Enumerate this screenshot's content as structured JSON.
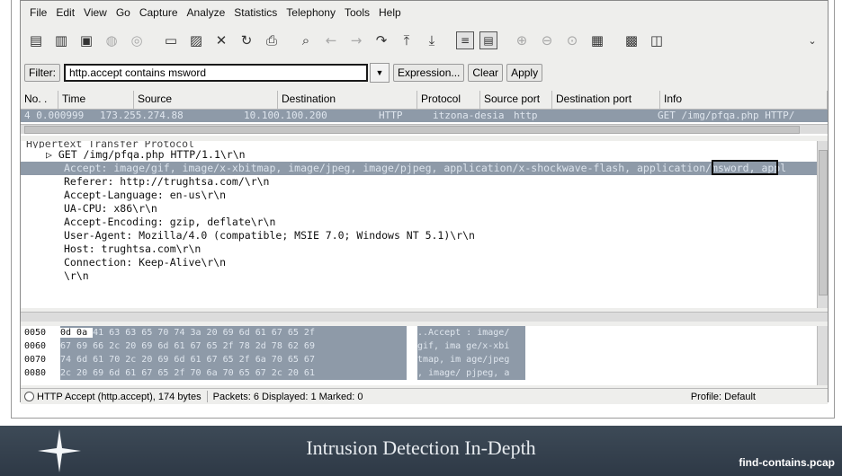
{
  "menu": [
    "File",
    "Edit",
    "View",
    "Go",
    "Capture",
    "Analyze",
    "Statistics",
    "Telephony",
    "Tools",
    "Help"
  ],
  "filter": {
    "label": "Filter:",
    "value": "http.accept contains msword",
    "expression_btn": "Expression...",
    "clear_btn": "Clear",
    "apply_btn": "Apply"
  },
  "packet_list": {
    "columns": [
      "No. .",
      "Time",
      "Source",
      "Destination",
      "Protocol",
      "Source port",
      "Destination port",
      "Info"
    ],
    "row": [
      "4 0.000999",
      "173.255.274.88",
      "10.100.100.200",
      "HTTP",
      "itzona-desia",
      "http",
      "",
      "GET /img/pfqa.php HTTP/"
    ]
  },
  "details": {
    "top": "Hypertext Transfer Protocol",
    "request_line": "GET /img/pfqa.php HTTP/1.1\\r\\n",
    "accept": "Accept: image/gif, image/x-xbitmap, image/jpeg, image/pjpeg, application/x-shockwave-flash, application/msword, appl",
    "headers": [
      "Referer: http://trughtsa.com/\\r\\n",
      "Accept-Language: en-us\\r\\n",
      "UA-CPU: x86\\r\\n",
      "Accept-Encoding: gzip, deflate\\r\\n",
      "User-Agent: Mozilla/4.0 (compatible; MSIE 7.0; Windows NT 5.1)\\r\\n",
      "Host: trughtsa.com\\r\\n",
      "Connection: Keep-Alive\\r\\n",
      "\\r\\n"
    ]
  },
  "bytes": [
    {
      "offset": "0050",
      "hex_pre": "0d 0a ",
      "hex": "41 63 63 65 70 74  3a 20 69 6d 61 67 65 2f",
      "ascii": "..Accept : image/"
    },
    {
      "offset": "0060",
      "hex_pre": "",
      "hex": "67 69 66 2c 20 69 6d 61  67 65 2f 78 2d 78 62 69",
      "ascii": "gif, ima ge/x-xbi"
    },
    {
      "offset": "0070",
      "hex_pre": "",
      "hex": "74 6d 61 70 2c 20 69 6d  61 67 65 2f 6a 70 65 67",
      "ascii": "tmap, im age/jpeg"
    },
    {
      "offset": "0080",
      "hex_pre": "",
      "hex": "2c 20 69 6d 61 67 65 2f  70 6a 70 65 67 2c 20 61",
      "ascii": ", image/ pjpeg, a"
    }
  ],
  "status": {
    "field": "HTTP Accept (http.accept), 174 bytes",
    "packets": "Packets: 6 Displayed: 1 Marked: 0",
    "profile": "Profile: Default"
  },
  "footer": {
    "title": "Intrusion Detection In-Depth",
    "filename": "find-contains.pcap"
  }
}
